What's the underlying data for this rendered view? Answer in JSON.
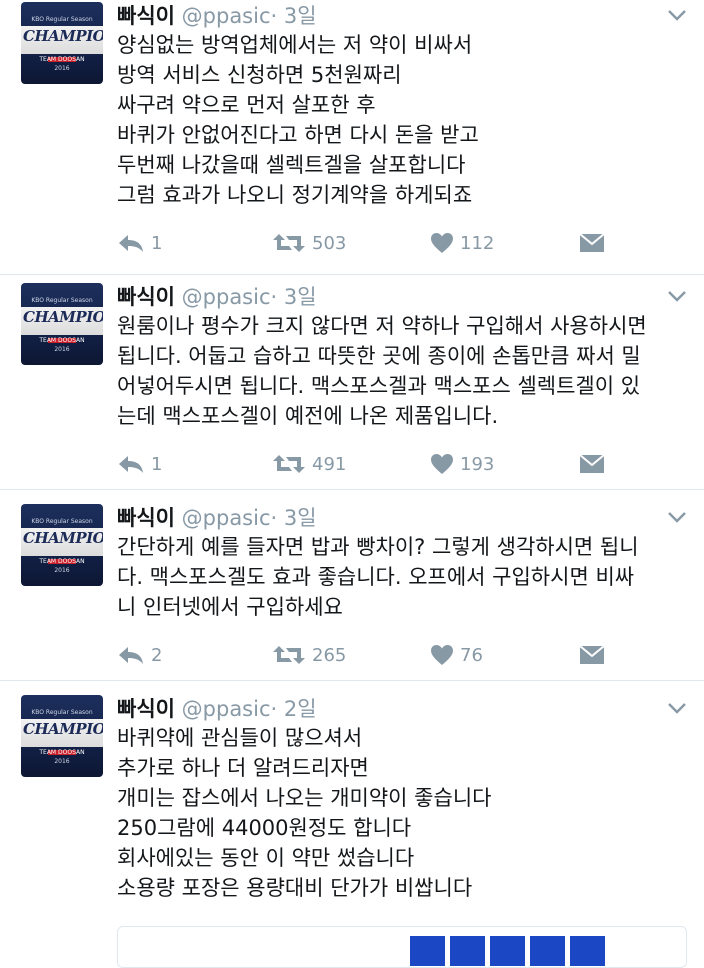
{
  "avatar_text": {
    "word": "CHAMPIONS",
    "top": "KBO Regular Season",
    "bottom": "TEAM DOOSAN",
    "year": "2016"
  },
  "colors": {
    "text": "#14171a",
    "muted": "#8899a6",
    "divider": "#e1e8ed"
  },
  "icons": [
    "reply-icon",
    "retweet-icon",
    "heart-icon",
    "direct-message-icon",
    "chevron-down-icon"
  ],
  "tweets": [
    {
      "name": "빠식이",
      "handle": "@ppasic",
      "time": "· 3일",
      "lines": [
        "양심없는 방역업체에서는 저 약이 비싸서",
        "방역 서비스 신청하면 5천원짜리",
        "싸구려 약으로 먼저 살포한 후",
        "바퀴가 안없어진다고 하면 다시 돈을 받고",
        "두번째 나갔을때 셀렉트겔을 살포합니다",
        "그럼 효과가 나오니 정기계약을 하게되죠"
      ],
      "replies": "1",
      "retweets": "503",
      "likes": "112"
    },
    {
      "name": "빠식이",
      "handle": "@ppasic",
      "time": "· 3일",
      "lines": [
        "원룸이나 평수가 크지 않다면 저 약하나 구입해서 사용하시면",
        "됩니다. 어둡고 습하고 따뜻한 곳에 종이에 손톱만큼 짜서 밀",
        "어넣어두시면 됩니다. 맥스포스겔과 맥스포스 셀렉트겔이 있",
        "는데 맥스포스겔이 예전에 나온 제품입니다."
      ],
      "replies": "1",
      "retweets": "491",
      "likes": "193"
    },
    {
      "name": "빠식이",
      "handle": "@ppasic",
      "time": "· 3일",
      "lines": [
        "간단하게 예를 들자면 밥과 빵차이? 그렇게 생각하시면 됩니",
        "다. 맥스포스겔도 효과 좋습니다. 오프에서 구입하시면 비싸",
        "니 인터넷에서 구입하세요"
      ],
      "replies": "2",
      "retweets": "265",
      "likes": "76"
    },
    {
      "name": "빠식이",
      "handle": "@ppasic",
      "time": "· 2일",
      "lines": [
        "바퀴약에 관심들이 많으셔서",
        "추가로 하나 더 알려드리자면",
        "개미는 잡스에서 나오는 개미약이 좋습니다",
        "250그람에 44000원정도 합니다",
        "회사에있는 동안 이 약만 썼습니다",
        "소용량 포장은 용량대비 단가가 비쌉니다"
      ]
    }
  ]
}
